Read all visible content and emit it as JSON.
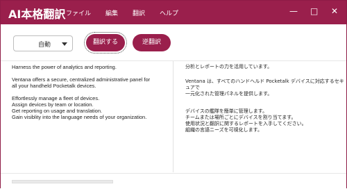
{
  "app": {
    "logo": "AI本格翻訳"
  },
  "menu": [
    "ファイル",
    "編集",
    "翻訳",
    "ヘルプ"
  ],
  "window_controls": {
    "minimize": "—",
    "maximize": "□",
    "close": "✕"
  },
  "toolbar": {
    "language_selected": "自動",
    "translate_label": "翻訳する",
    "reverse_label": "逆翻訳"
  },
  "source": {
    "para1": "Harness the power of analytics and reporting.",
    "para2": [
      "Ventana offers a secure, centralized administrative panel for",
      "all your handheld Pocketalk devices."
    ],
    "para3": [
      "Effortlessly manage a fleet of devices.",
      "Assign devices by team or location.",
      "Get reporting on usage and translation.",
      "Gain visiblity into the language needs of your organization."
    ]
  },
  "target": {
    "para1": "分析とレポートの力を活用しています。",
    "para2": [
      "Ventana は、すべてのハンドヘルド Pocketalk デバイスに対応するセキュアで",
      "一元化された管理パネルを提供します。"
    ],
    "para3": [
      "デバイスの艦隊を簡単に管理します。",
      "チームまたは場所ごとにデバイスを割り当てます。",
      "使用状況と翻訳に関するレポートを入手してください。",
      "組織の言語ニーズを可視化します。"
    ]
  },
  "progress": {
    "percent": 0
  },
  "colors": {
    "brand": "#9a1f4c"
  }
}
